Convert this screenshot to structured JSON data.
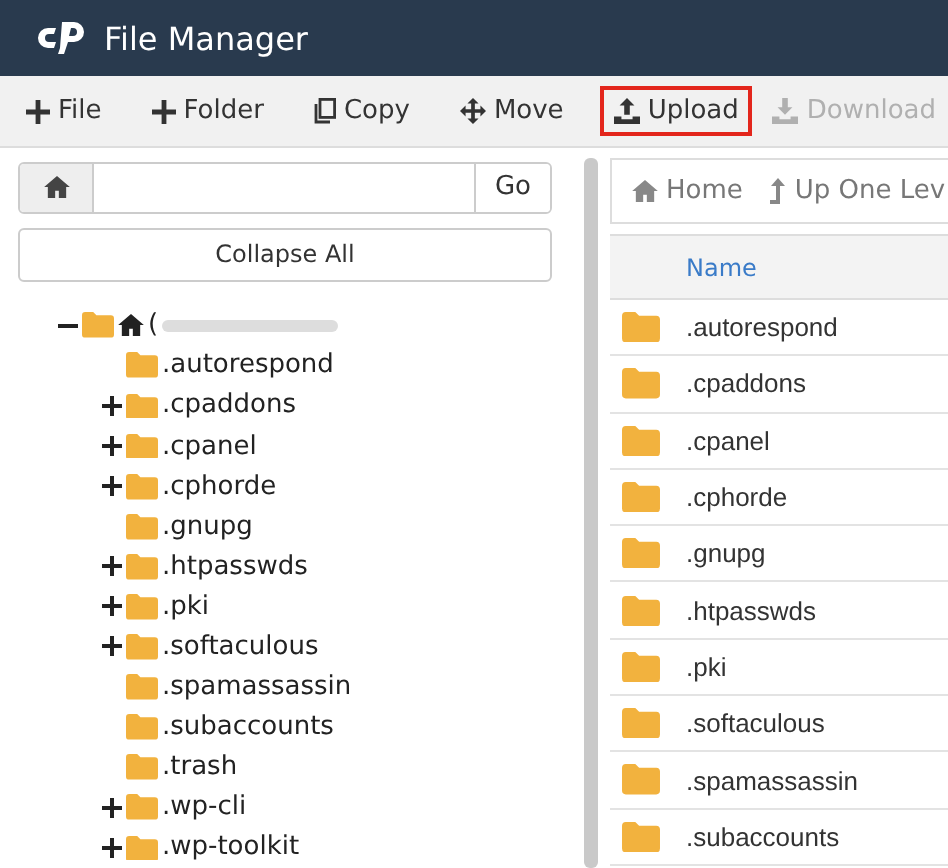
{
  "header": {
    "title": "File Manager"
  },
  "toolbar": [
    {
      "label": "File",
      "kind": "plus",
      "disabled": false,
      "highlighted": false
    },
    {
      "label": "Folder",
      "kind": "plus",
      "disabled": false,
      "highlighted": false
    },
    {
      "label": "Copy",
      "kind": "copy",
      "disabled": false,
      "highlighted": false
    },
    {
      "label": "Move",
      "kind": "move",
      "disabled": false,
      "highlighted": false
    },
    {
      "label": "Upload",
      "kind": "upload",
      "disabled": false,
      "highlighted": true
    },
    {
      "label": "Download",
      "kind": "download",
      "disabled": true,
      "highlighted": false
    }
  ],
  "path_bar": {
    "go": "Go"
  },
  "collapse_button": "Collapse All",
  "tree": {
    "label": "(",
    "expanded": true,
    "children": [
      {
        "label": ".autorespond",
        "expandable": false
      },
      {
        "label": ".cpaddons",
        "expandable": true
      },
      {
        "label": ".cpanel",
        "expandable": true
      },
      {
        "label": ".cphorde",
        "expandable": true
      },
      {
        "label": ".gnupg",
        "expandable": false
      },
      {
        "label": ".htpasswds",
        "expandable": true
      },
      {
        "label": ".pki",
        "expandable": true
      },
      {
        "label": ".softaculous",
        "expandable": true
      },
      {
        "label": ".spamassassin",
        "expandable": false
      },
      {
        "label": ".subaccounts",
        "expandable": false
      },
      {
        "label": ".trash",
        "expandable": false
      },
      {
        "label": ".wp-cli",
        "expandable": true
      },
      {
        "label": ".wp-toolkit",
        "expandable": true
      }
    ]
  },
  "nav": [
    {
      "label": "Home",
      "kind": "home"
    },
    {
      "label": "Up One Lev",
      "kind": "up"
    }
  ],
  "table": {
    "columns": [
      "Name"
    ],
    "rows": [
      ".autorespond",
      ".cpaddons",
      ".cpanel",
      ".cphorde",
      ".gnupg",
      ".htpasswds",
      ".pki",
      ".softaculous",
      ".spamassassin",
      ".subaccounts"
    ]
  }
}
